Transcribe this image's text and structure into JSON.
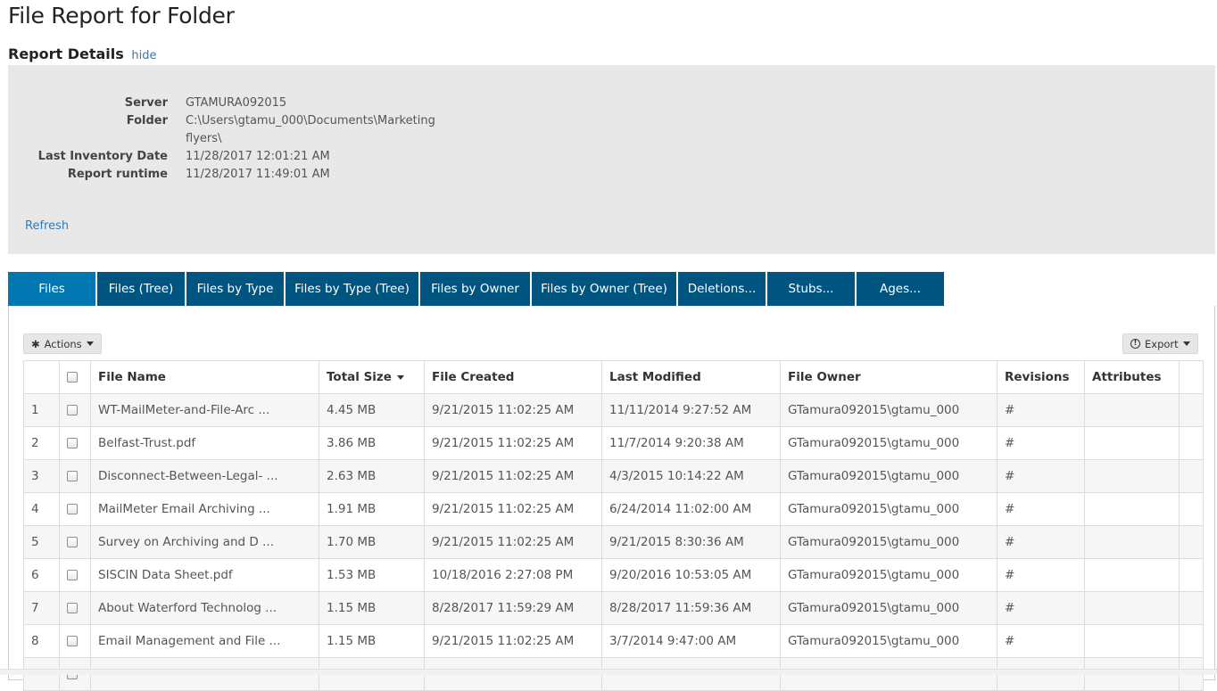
{
  "page": {
    "title": "File Report for Folder"
  },
  "details": {
    "heading": "Report Details",
    "hide_label": "hide",
    "rows": [
      {
        "label": "Server",
        "value": "GTAMURA092015"
      },
      {
        "label": "Folder",
        "value": "C:\\Users\\gtamu_000\\Documents\\Marketing flyers\\"
      },
      {
        "label": "Last Inventory Date",
        "value": "11/28/2017 12:01:21 AM"
      },
      {
        "label": "Report runtime",
        "value": "11/28/2017 11:49:01 AM"
      }
    ],
    "refresh_label": "Refresh"
  },
  "tabs": [
    {
      "label": "Files",
      "active": true
    },
    {
      "label": "Files (Tree)"
    },
    {
      "label": "Files by Type"
    },
    {
      "label": "Files by Type (Tree)"
    },
    {
      "label": "Files by Owner"
    },
    {
      "label": "Files by Owner (Tree)"
    },
    {
      "label": "Deletions..."
    },
    {
      "label": "Stubs..."
    },
    {
      "label": "Ages..."
    }
  ],
  "toolbar": {
    "actions_label": "Actions",
    "export_label": "Export"
  },
  "table": {
    "columns": [
      "",
      "",
      "File Name",
      "Total Size",
      "File Created",
      "Last Modified",
      "File Owner",
      "Revisions",
      "Attributes",
      ""
    ],
    "sorted_column": "Total Size",
    "rows": [
      {
        "num": "1",
        "name": "WT-MailMeter-and-File-Arc ...",
        "size": "4.45 MB",
        "created": "9/21/2015 11:02:25 AM",
        "modified": "11/11/2014 9:27:52 AM",
        "owner": "GTamura092015\\gtamu_000",
        "rev": "#"
      },
      {
        "num": "2",
        "name": "Belfast-Trust.pdf",
        "size": "3.86 MB",
        "created": "9/21/2015 11:02:25 AM",
        "modified": "11/7/2014 9:20:38 AM",
        "owner": "GTamura092015\\gtamu_000",
        "rev": "#"
      },
      {
        "num": "3",
        "name": "Disconnect-Between-Legal- ...",
        "size": "2.63 MB",
        "created": "9/21/2015 11:02:25 AM",
        "modified": "4/3/2015 10:14:22 AM",
        "owner": "GTamura092015\\gtamu_000",
        "rev": "#"
      },
      {
        "num": "4",
        "name": "MailMeter Email Archiving ...",
        "size": "1.91 MB",
        "created": "9/21/2015 11:02:25 AM",
        "modified": "6/24/2014 11:02:00 AM",
        "owner": "GTamura092015\\gtamu_000",
        "rev": "#"
      },
      {
        "num": "5",
        "name": "Survey on Archiving and D ...",
        "size": "1.70 MB",
        "created": "9/21/2015 11:02:25 AM",
        "modified": "9/21/2015 8:30:36 AM",
        "owner": "GTamura092015\\gtamu_000",
        "rev": "#"
      },
      {
        "num": "6",
        "name": "SISCIN Data Sheet.pdf",
        "size": "1.53 MB",
        "created": "10/18/2016 2:27:08 PM",
        "modified": "9/20/2016 10:53:05 AM",
        "owner": "GTamura092015\\gtamu_000",
        "rev": "#"
      },
      {
        "num": "7",
        "name": "About Waterford Technolog ...",
        "size": "1.15 MB",
        "created": "8/28/2017 11:59:29 AM",
        "modified": "8/28/2017 11:59:36 AM",
        "owner": "GTamura092015\\gtamu_000",
        "rev": "#"
      },
      {
        "num": "8",
        "name": "Email Management and File ...",
        "size": "1.15 MB",
        "created": "9/21/2015 11:02:25 AM",
        "modified": "3/7/2014 9:47:00 AM",
        "owner": "GTamura092015\\gtamu_000",
        "rev": "#"
      },
      {
        "num": "",
        "name": "",
        "size": "",
        "created": "",
        "modified": "",
        "owner": "",
        "rev": ""
      }
    ]
  }
}
